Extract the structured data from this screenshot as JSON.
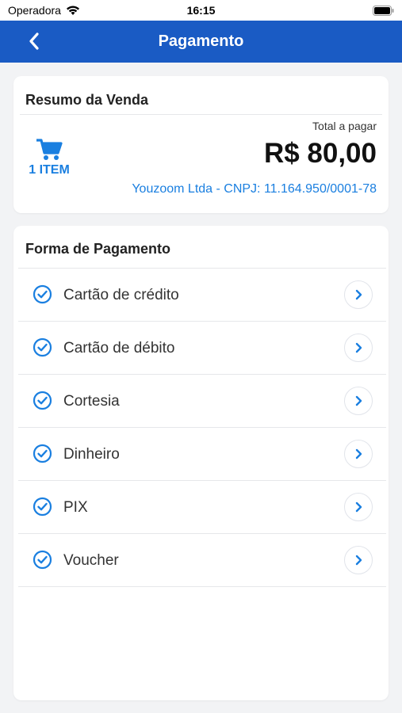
{
  "status_bar": {
    "carrier": "Operadora",
    "time": "16:15"
  },
  "nav": {
    "title": "Pagamento",
    "back_icon": "chevron-left-icon"
  },
  "summary": {
    "title": "Resumo da Venda",
    "item_count": "1 ITEM",
    "cart_icon": "cart-icon",
    "total_label": "Total a pagar",
    "total_value": "R$ 80,00",
    "company": "Youzoom Ltda - CNPJ: 11.164.950/0001-78"
  },
  "payment": {
    "title": "Forma de Pagamento",
    "methods": [
      {
        "label": "Cartão de crédito"
      },
      {
        "label": "Cartão de débito"
      },
      {
        "label": "Cortesia"
      },
      {
        "label": "Dinheiro"
      },
      {
        "label": "PIX"
      },
      {
        "label": "Voucher"
      }
    ]
  },
  "colors": {
    "nav_background": "#1a5bc4",
    "accent": "#1a7fe0",
    "page_background": "#f2f3f5"
  }
}
